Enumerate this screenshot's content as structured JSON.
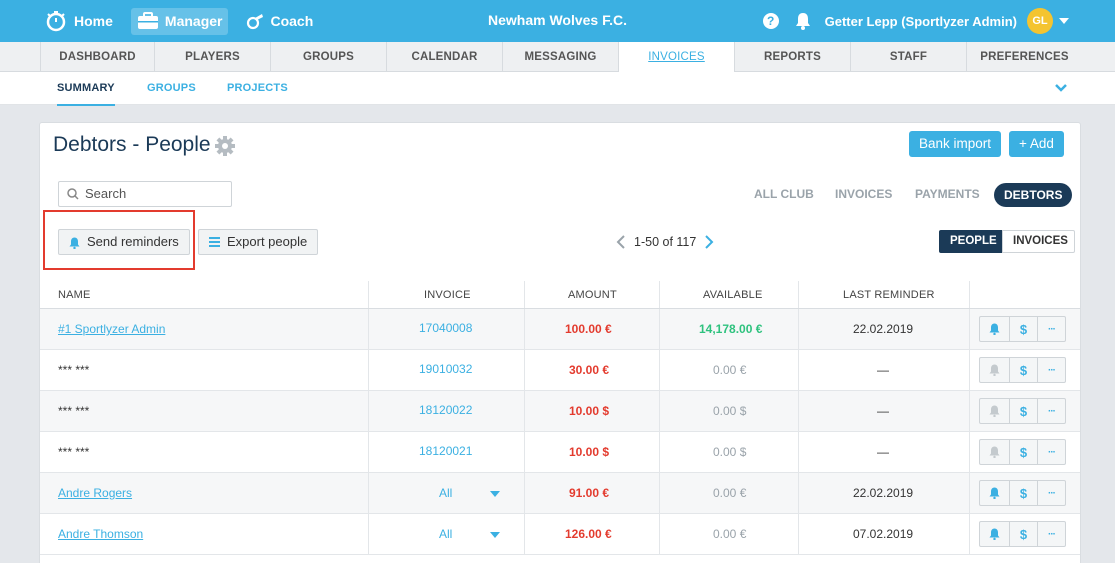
{
  "topbar": {
    "nav": [
      {
        "label": "Home",
        "icon": "stopwatch-icon"
      },
      {
        "label": "Manager",
        "icon": "briefcase-icon",
        "active": true
      },
      {
        "label": "Coach",
        "icon": "whistle-icon"
      }
    ],
    "club_name": "Newham Wolves F.C.",
    "user_name": "Getter Lepp (Sportlyzer Admin)",
    "user_initials": "GL",
    "help_label": "?"
  },
  "main_tabs": [
    "DASHBOARD",
    "PLAYERS",
    "GROUPS",
    "CALENDAR",
    "MESSAGING",
    "INVOICES",
    "REPORTS",
    "STAFF",
    "PREFERENCES"
  ],
  "main_tabs_active": "INVOICES",
  "sub_tabs": [
    "SUMMARY",
    "GROUPS",
    "PROJECTS"
  ],
  "page": {
    "title": "Debtors - People",
    "bank_import_label": "Bank import",
    "add_label": "+ Add",
    "search_placeholder": "Search",
    "filters": [
      "ALL CLUB",
      "INVOICES",
      "PAYMENTS",
      "DEBTORS"
    ],
    "active_filter": "DEBTORS",
    "send_reminders_label": "Send reminders",
    "export_people_label": "Export people",
    "pager_text": "1-50 of 117",
    "view_toggle": [
      "PEOPLE",
      "INVOICES"
    ],
    "active_view": "PEOPLE"
  },
  "table": {
    "headers": {
      "name": "NAME",
      "invoice": "INVOICE",
      "amount": "AMOUNT",
      "available": "AVAILABLE",
      "last_reminder": "LAST REMINDER"
    },
    "rows": [
      {
        "name": "#1 Sportlyzer Admin",
        "link": true,
        "invoice": "17040008",
        "amount": "100.00 €",
        "available": "14,178.00 €",
        "available_positive": true,
        "last_reminder": "22.02.2019",
        "bell_active": true
      },
      {
        "name": "*** ***",
        "link": false,
        "invoice": "19010032",
        "amount": "30.00 €",
        "available": "0.00 €",
        "available_positive": false,
        "last_reminder": "—",
        "bell_active": false
      },
      {
        "name": "*** ***",
        "link": false,
        "invoice": "18120022",
        "amount": "10.00 $",
        "available": "0.00 $",
        "available_positive": false,
        "last_reminder": "—",
        "bell_active": false
      },
      {
        "name": "*** ***",
        "link": false,
        "invoice": "18120021",
        "amount": "10.00 $",
        "available": "0.00 $",
        "available_positive": false,
        "last_reminder": "—",
        "bell_active": false
      },
      {
        "name": "Andre Rogers",
        "link": true,
        "invoice": "All",
        "dropdown": true,
        "amount": "91.00 €",
        "available": "0.00 €",
        "available_positive": false,
        "last_reminder": "22.02.2019",
        "bell_active": true
      },
      {
        "name": "Andre Thomson",
        "link": true,
        "invoice": "All",
        "dropdown": true,
        "amount": "126.00 €",
        "available": "0.00 €",
        "available_positive": false,
        "last_reminder": "07.02.2019",
        "bell_active": true
      }
    ],
    "action_dollar_label": "$",
    "action_more_label": "···"
  },
  "colors": {
    "brand": "#3bb0e2",
    "navy": "#1b3a57",
    "debt_red": "#e33b2e",
    "credit_green": "#2ec27e",
    "highlight_red": "#e33b2e"
  }
}
